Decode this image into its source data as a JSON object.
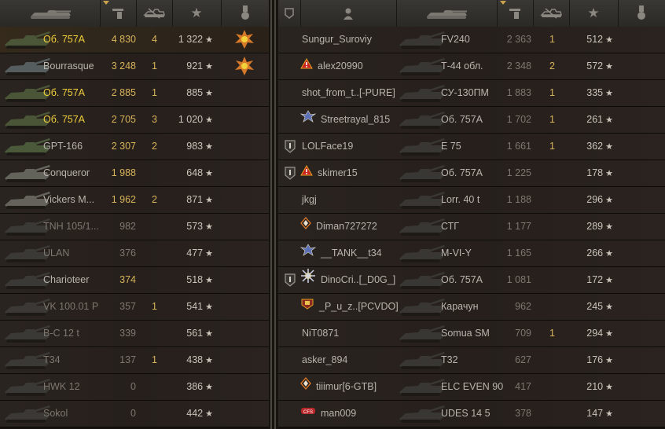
{
  "left_team": [
    {
      "name": "Об. 757А",
      "dmg": "4 830",
      "kills": "4",
      "xp": "1 322",
      "medal": "orange",
      "name_color": "yellow",
      "dmg_color": "gold",
      "hl": true
    },
    {
      "name": "Bourrasque",
      "dmg": "3 248",
      "kills": "1",
      "xp": "921",
      "medal": "orange",
      "name_color": "normal",
      "dmg_color": "gold",
      "hl": false
    },
    {
      "name": "Об. 757А",
      "dmg": "2 885",
      "kills": "1",
      "xp": "885",
      "medal": "",
      "name_color": "yellow",
      "dmg_color": "gold",
      "hl": false
    },
    {
      "name": "Об. 757А",
      "dmg": "2 705",
      "kills": "3",
      "xp": "1 020",
      "medal": "",
      "name_color": "yellow",
      "dmg_color": "gold",
      "hl": false
    },
    {
      "name": "GPT-166",
      "dmg": "2 307",
      "kills": "2",
      "xp": "983",
      "medal": "",
      "name_color": "normal",
      "dmg_color": "gold",
      "hl": false
    },
    {
      "name": "Conqueror",
      "dmg": "1 988",
      "kills": "",
      "xp": "648",
      "medal": "",
      "name_color": "normal",
      "dmg_color": "gold",
      "hl": false
    },
    {
      "name": "Vickers M...",
      "dmg": "1 962",
      "kills": "2",
      "xp": "871",
      "medal": "",
      "name_color": "normal",
      "dmg_color": "gold",
      "hl": false
    },
    {
      "name": "TNH 105/1...",
      "dmg": "982",
      "kills": "",
      "xp": "573",
      "medal": "",
      "name_color": "dim",
      "dmg_color": "dim",
      "hl": false
    },
    {
      "name": "ULAN",
      "dmg": "376",
      "kills": "",
      "xp": "477",
      "medal": "",
      "name_color": "dim",
      "dmg_color": "dim",
      "hl": false
    },
    {
      "name": "Charioteer",
      "dmg": "374",
      "kills": "",
      "xp": "518",
      "medal": "",
      "name_color": "normal",
      "dmg_color": "gold",
      "hl": false
    },
    {
      "name": "VK 100.01 P",
      "dmg": "357",
      "kills": "1",
      "xp": "541",
      "medal": "",
      "name_color": "dim",
      "dmg_color": "dim",
      "hl": false
    },
    {
      "name": "B-C 12 t",
      "dmg": "339",
      "kills": "",
      "xp": "561",
      "medal": "",
      "name_color": "dim",
      "dmg_color": "dim",
      "hl": false
    },
    {
      "name": "T34",
      "dmg": "137",
      "kills": "1",
      "xp": "438",
      "medal": "",
      "name_color": "dim",
      "dmg_color": "dim",
      "hl": false
    },
    {
      "name": "HWK 12",
      "dmg": "0",
      "kills": "",
      "xp": "386",
      "medal": "",
      "name_color": "dim",
      "dmg_color": "dim",
      "hl": false
    },
    {
      "name": "Sokol",
      "dmg": "0",
      "kills": "",
      "xp": "442",
      "medal": "",
      "name_color": "dim",
      "dmg_color": "dim",
      "hl": false
    }
  ],
  "right_team": [
    {
      "player": "Sungur_Suroviy",
      "icon": "",
      "clan": false,
      "tank": "FV240",
      "dmg": "2 363",
      "kills": "1",
      "xp": "512"
    },
    {
      "player": "alex20990",
      "icon": "warning-icon",
      "clan": false,
      "tank": "Т-44 обл.",
      "dmg": "2 348",
      "kills": "2",
      "xp": "572"
    },
    {
      "player": "shot_from_t..[-PURE]",
      "icon": "",
      "clan": false,
      "tank": "СУ-130ПМ",
      "dmg": "1 883",
      "kills": "1",
      "xp": "335"
    },
    {
      "player": "Streetrayal_815",
      "icon": "rank-wings-icon",
      "clan": false,
      "tank": "Об. 757А",
      "dmg": "1 702",
      "kills": "1",
      "xp": "261"
    },
    {
      "player": "LOLFace19",
      "icon": "",
      "clan": true,
      "tank": "E 75",
      "dmg": "1 661",
      "kills": "1",
      "xp": "362"
    },
    {
      "player": "skimer15",
      "icon": "warning-icon",
      "clan": true,
      "tank": "Об. 757А",
      "dmg": "1 225",
      "kills": "",
      "xp": "178"
    },
    {
      "player": "jkgj",
      "icon": "",
      "clan": false,
      "tank": "Lorr. 40 t",
      "dmg": "1 188",
      "kills": "",
      "xp": "296"
    },
    {
      "player": "Diman727272",
      "icon": "diamond-icon",
      "clan": false,
      "tank": "СТГ",
      "dmg": "1 177",
      "kills": "",
      "xp": "289"
    },
    {
      "player": "__TANK__t34",
      "icon": "rank-wings-icon",
      "clan": false,
      "tank": "M-VI-Y",
      "dmg": "1 165",
      "kills": "",
      "xp": "266"
    },
    {
      "player": "DinoCri..[_D0G_]",
      "icon": "sun-badge-icon",
      "clan": true,
      "tank": "Об. 757А",
      "dmg": "1 081",
      "kills": "",
      "xp": "172"
    },
    {
      "player": "_P_u_z..[PCVDO]",
      "icon": "shield-badge-icon",
      "clan": false,
      "tank": "Карачун",
      "dmg": "962",
      "kills": "",
      "xp": "245"
    },
    {
      "player": "NiT0871",
      "icon": "",
      "clan": false,
      "tank": "Somua SM",
      "dmg": "709",
      "kills": "1",
      "xp": "294"
    },
    {
      "player": "asker_894",
      "icon": "",
      "clan": false,
      "tank": "T32",
      "dmg": "627",
      "kills": "",
      "xp": "176"
    },
    {
      "player": "tiiimur[6-GTB]",
      "icon": "diamond-icon",
      "clan": false,
      "tank": "ELC EVEN 90",
      "dmg": "417",
      "kills": "",
      "xp": "210"
    },
    {
      "player": "man009",
      "icon": "ribbon-icon",
      "clan": false,
      "tank": "UDES 14 5",
      "dmg": "378",
      "kills": "",
      "xp": "147"
    }
  ],
  "colors": {
    "yellow": "#f2d23b",
    "gold": "#d7b45a",
    "text": "#b9b5ad",
    "dim": "#7d776f"
  }
}
